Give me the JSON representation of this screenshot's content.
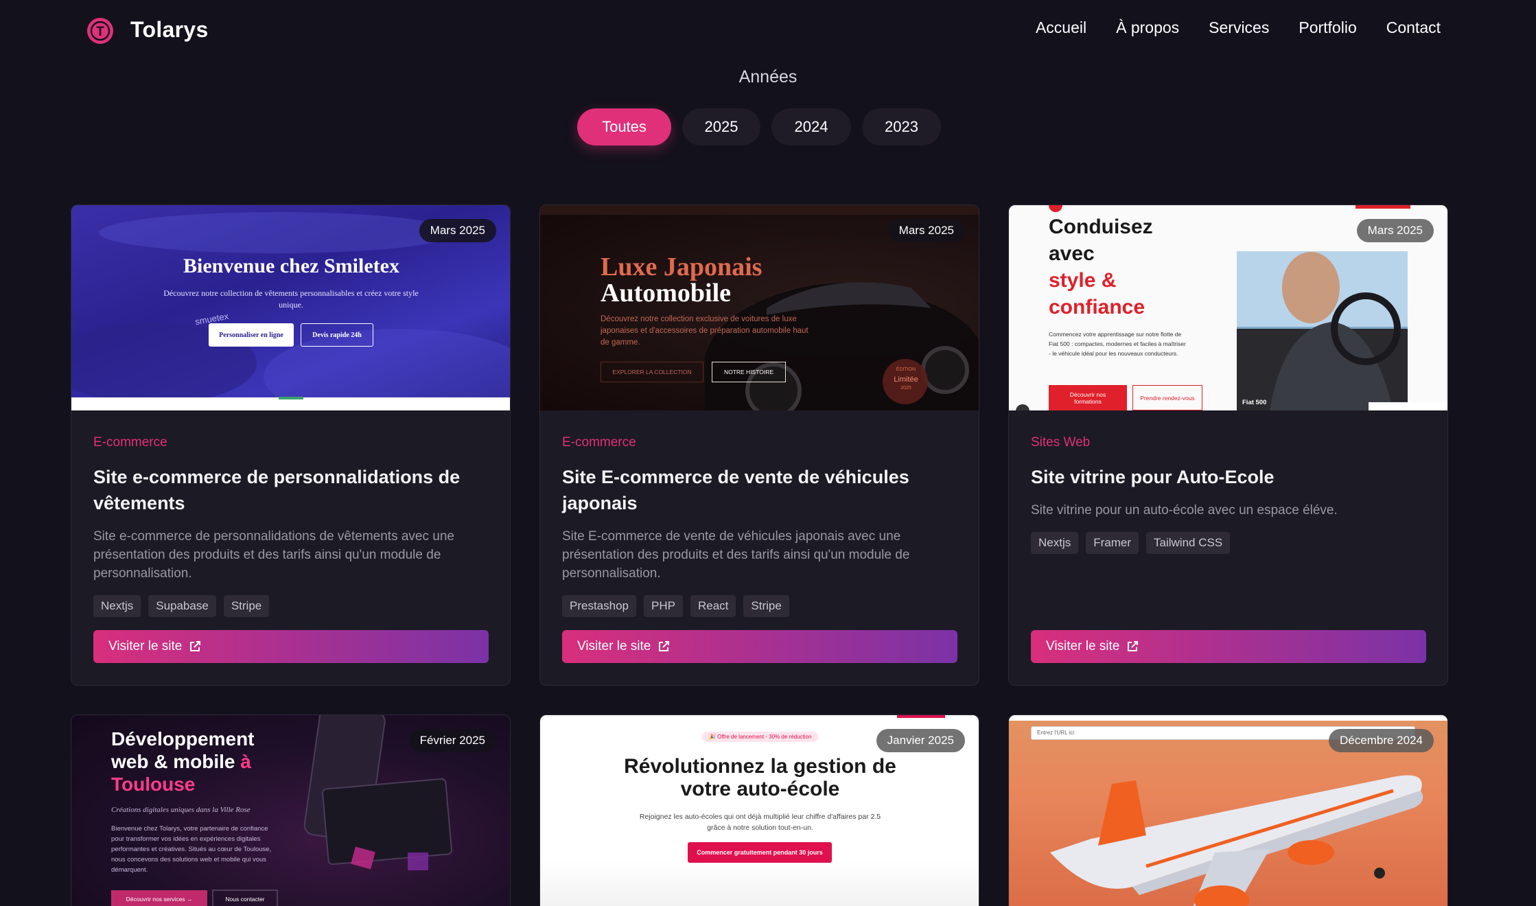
{
  "nav": {
    "brand": "Tolarys",
    "logo_letter": "T",
    "links": [
      "Accueil",
      "À propos",
      "Services",
      "Portfolio",
      "Contact"
    ]
  },
  "filter": {
    "title": "Années",
    "options": [
      "Toutes",
      "2025",
      "2024",
      "2023"
    ],
    "active": "Toutes"
  },
  "colors": {
    "accent": "#e0307a",
    "background": "#13111c",
    "card": "#1c1a24",
    "gradient_end": "#7b32a6"
  },
  "projects": [
    {
      "date": "Mars 2025",
      "category": "E-commerce",
      "title": "Site e-commerce de personnalidations de vêtements",
      "description": "Site e-commerce de personnalidations de vêtements avec une présentation des produits et des tarifs ainsi qu'un module de personnalisation.",
      "tags": [
        "Nextjs",
        "Supabase",
        "Stripe"
      ],
      "cta": "Visiter le site",
      "preview": {
        "heading": "Bienvenue chez Smiletex",
        "sub": "Découvrez notre collection de vêtements personnalisables et créez votre style unique.",
        "btn1": "Personnaliser en ligne",
        "btn2": "Devis rapide 24h",
        "watermark": "smuetex"
      }
    },
    {
      "date": "Mars 2025",
      "category": "E-commerce",
      "title": "Site E-commerce de vente de véhicules japonais",
      "description": "Site E-commerce de vente de véhicules japonais avec une présentation des produits et des tarifs ainsi qu'un module de personnalisation.",
      "tags": [
        "Prestashop",
        "PHP",
        "React",
        "Stripe"
      ],
      "cta": "Visiter le site",
      "preview": {
        "heading1": "Luxe Japonais",
        "heading2": "Automobile",
        "sub": "Découvrez notre collection exclusive de voitures de luxe japonaises et d'accessoires de préparation automobile haut de gamme.",
        "btn1": "EXPLORER LA COLLECTION",
        "btn2": "NOTRE HISTOIRE",
        "badge_top": "ÉDITION",
        "badge_main": "Limitée",
        "badge_year": "2025"
      }
    },
    {
      "date": "Mars 2025",
      "category": "Sites Web",
      "title": "Site vitrine pour Auto-Ecole",
      "description": "Site vitrine pour un auto-école avec un espace éléve.",
      "tags": [
        "Nextjs",
        "Framer",
        "Tailwind CSS"
      ],
      "cta": "Visiter le site",
      "preview": {
        "line1": "Conduisez",
        "line2": "avec",
        "line3": "style &",
        "line4": "confiance",
        "sub": "Commencez votre apprentissage sur notre flotte de Fiat 500 : compactes, modernes et faciles à maîtriser - le véhicule idéal pour les nouveaux conducteurs.",
        "btn1": "Découvrir nos formations",
        "btn2": "Prendre rendez-vous",
        "caption": "Fiat 500"
      }
    },
    {
      "date": "Février 2025",
      "preview": {
        "line1": "Développement",
        "line2": "web & mobile",
        "accent_a": "à",
        "line3": "Toulouse",
        "tagline": "Créations digitales uniques dans la Ville Rose",
        "sub": "Bienvenue chez Tolarys, votre partenaire de confiance pour transformer vos idées en expériences digitales performantes et créatives. Situés au cœur de Toulouse, nous concevons des solutions web et mobile qui vous démarquent.",
        "btn1": "Découvrir nos services →",
        "btn2": "Nous contacter"
      }
    },
    {
      "date": "Janvier 2025",
      "preview": {
        "promo": "🎉 Offre de lancement - 30% de réduction",
        "heading1": "Révolutionnez la gestion de",
        "heading2": "votre auto-école",
        "sub1": "Rejoignez les auto-écoles qui ont déjà multiplié leur chiffre d'affaires par 2.5",
        "sub2": "grâce à notre solution tout-en-un.",
        "btn": "Commencer gratuitement pendant 30 jours"
      }
    },
    {
      "date": "Décembre 2024",
      "preview": {
        "url_placeholder": "Entrez l'URL ici"
      }
    }
  ]
}
